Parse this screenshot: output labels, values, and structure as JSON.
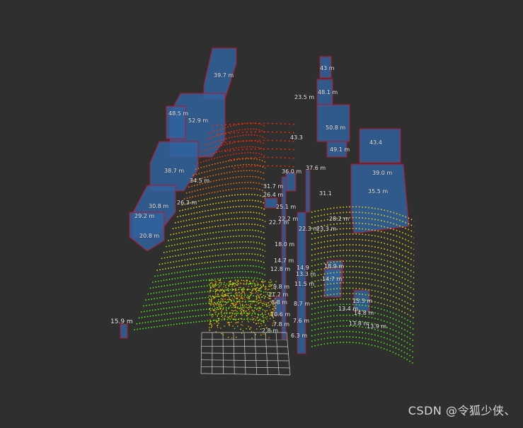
{
  "scene": {
    "background": "#2f2f2f",
    "box_fill": "#2f64a0",
    "box_edge": "#c0102a",
    "grid_color": "#cfcfcf",
    "point_colors": [
      "#ff2a00",
      "#ff7a00",
      "#f7e000",
      "#b6f000",
      "#4cff00"
    ],
    "labels": [
      {
        "text": "39.7 m"
      },
      {
        "text": "23.5 m"
      },
      {
        "text": "43 m"
      },
      {
        "text": "48.1 m"
      },
      {
        "text": "48.5 m"
      },
      {
        "text": "52.9 m"
      },
      {
        "text": "50.8 m"
      },
      {
        "text": "49.1 m"
      },
      {
        "text": "43.4"
      },
      {
        "text": "43.3"
      },
      {
        "text": "38.7 m"
      },
      {
        "text": "36.0 m"
      },
      {
        "text": "37.6 m"
      },
      {
        "text": "39.0 m"
      },
      {
        "text": "34.5 m"
      },
      {
        "text": "31.7 m"
      },
      {
        "text": "35.5 m"
      },
      {
        "text": "26.4 m"
      },
      {
        "text": "31.1"
      },
      {
        "text": "30.8 m"
      },
      {
        "text": "26.3 m"
      },
      {
        "text": "29.2 m"
      },
      {
        "text": "25.1 m"
      },
      {
        "text": "28.2 m"
      },
      {
        "text": "20.8 m"
      },
      {
        "text": "22.7 m"
      },
      {
        "text": "22.3 m"
      },
      {
        "text": "22.2 m"
      },
      {
        "text": "23.3 m"
      },
      {
        "text": "18.0 m"
      },
      {
        "text": "14.7 m"
      },
      {
        "text": "12.8 m"
      },
      {
        "text": "14.9"
      },
      {
        "text": "13.3 m"
      },
      {
        "text": "18.9 m"
      },
      {
        "text": "11.5 m"
      },
      {
        "text": "14.7 m"
      },
      {
        "text": "9.8 m"
      },
      {
        "text": "11.2 m"
      },
      {
        "text": "15.3 m"
      },
      {
        "text": "8.8 m"
      },
      {
        "text": "8.7 m"
      },
      {
        "text": "13.4 m"
      },
      {
        "text": "14.8 m"
      },
      {
        "text": "10.6 m"
      },
      {
        "text": "7.8 m"
      },
      {
        "text": "7.6 m"
      },
      {
        "text": "13.8 m"
      },
      {
        "text": "13.9 m"
      },
      {
        "text": "2.8 m"
      },
      {
        "text": "6.3 m"
      },
      {
        "text": "15.9 m"
      }
    ]
  },
  "watermark": "CSDN @令狐少侠、"
}
